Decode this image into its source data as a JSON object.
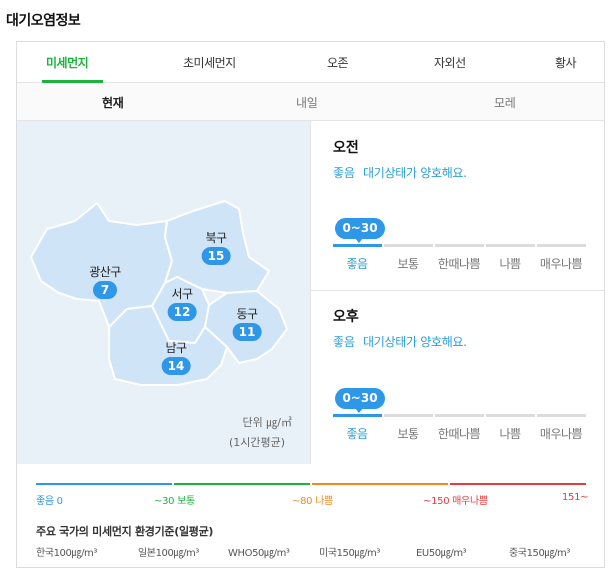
{
  "page_title": "대기오염정보",
  "tabs": [
    "미세먼지",
    "초미세먼지",
    "오존",
    "자외선",
    "황사"
  ],
  "subtabs": [
    "현재",
    "내일",
    "모레"
  ],
  "districts": [
    {
      "name": "광산구",
      "value": "7"
    },
    {
      "name": "북구",
      "value": "15"
    },
    {
      "name": "서구",
      "value": "12"
    },
    {
      "name": "동구",
      "value": "11"
    },
    {
      "name": "남구",
      "value": "14"
    }
  ],
  "unit": {
    "label": "단위 ㎍/㎥",
    "sub": "(1시간평균)"
  },
  "forecast": {
    "am": {
      "title": "오전",
      "grade": "좋음",
      "desc": "대기상태가 양호해요.",
      "range": "0~30"
    },
    "pm": {
      "title": "오후",
      "grade": "좋음",
      "desc": "대기상태가 양호해요.",
      "range": "0~30"
    },
    "levels": [
      "좋음",
      "보통",
      "한때나쁨",
      "나쁨",
      "매우나쁨"
    ]
  },
  "legend": {
    "good": "좋음 0",
    "normal": "~30 보통",
    "bad": "~80 나쁨",
    "very_bad": "~150 매우나쁨",
    "max": "151~",
    "colors": {
      "good": "#2e97e8",
      "normal": "#1bb33e",
      "bad": "#f08a1d",
      "very_bad": "#e43c3c"
    }
  },
  "standards": {
    "title": "주요 국가의 미세먼지 환경기준(일평균)",
    "items": [
      "한국100㎍/m³",
      "일본100㎍/m³",
      "WHO50㎍/m³",
      "미국150㎍/m³",
      "EU50㎍/m³",
      "중국150㎍/m³"
    ]
  }
}
